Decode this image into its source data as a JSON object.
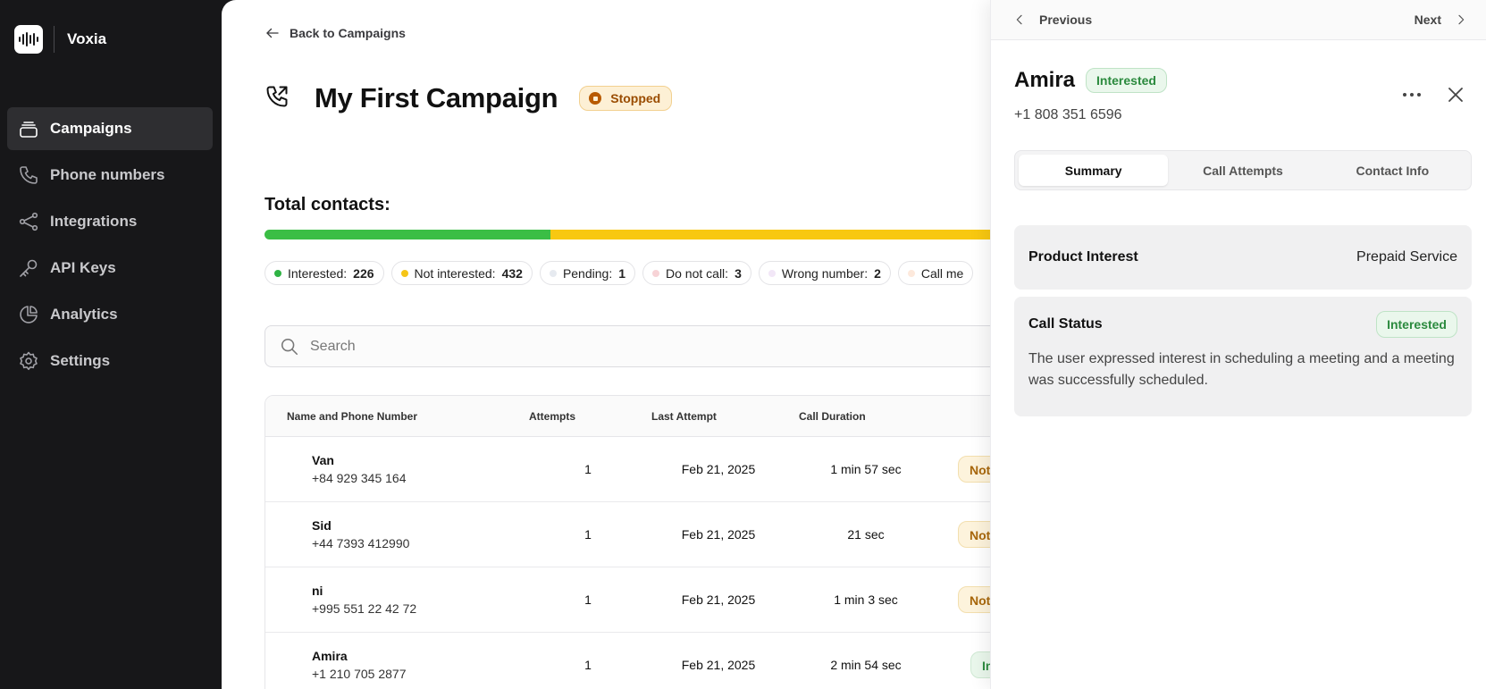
{
  "app": {
    "name": "Voxia"
  },
  "sidebar": {
    "items": [
      {
        "label": "Campaigns",
        "icon": "campaigns-icon",
        "active": true
      },
      {
        "label": "Phone numbers",
        "icon": "phone-icon"
      },
      {
        "label": "Integrations",
        "icon": "integrations-icon"
      },
      {
        "label": "API Keys",
        "icon": "key-icon"
      },
      {
        "label": "Analytics",
        "icon": "pie-chart-icon"
      },
      {
        "label": "Settings",
        "icon": "gear-icon"
      }
    ]
  },
  "header": {
    "back_label": "Back to Campaigns",
    "title": "My First Campaign",
    "status": "Stopped"
  },
  "contacts": {
    "total_label": "Total contacts:",
    "interested_fraction": 0.39,
    "chips": [
      {
        "label": "Interested:",
        "count": "226",
        "color": "#2fb344"
      },
      {
        "label": "Not interested:",
        "count": "432",
        "color": "#f5c518"
      },
      {
        "label": "Pending:",
        "count": "1",
        "color": "#e6eaf0"
      },
      {
        "label": "Do not call:",
        "count": "3",
        "color": "#f7d3d6"
      },
      {
        "label": "Wrong number:",
        "count": "2",
        "color": "#f2e7f7"
      },
      {
        "label": "Call me",
        "count": "",
        "color": "#fde9dc"
      }
    ]
  },
  "search": {
    "placeholder": "Search",
    "value": ""
  },
  "table": {
    "columns": [
      "Name and Phone Number",
      "Attempts",
      "Last Attempt",
      "Call Duration"
    ],
    "rows": [
      {
        "name": "Van",
        "phone": "+84 929 345 164",
        "attempts": "1",
        "last": "Feb 21, 2025",
        "duration": "1 min 57 sec",
        "status": "Not",
        "kind": "ni"
      },
      {
        "name": "Sid",
        "phone": "+44 7393 412990",
        "attempts": "1",
        "last": "Feb 21, 2025",
        "duration": "21 sec",
        "status": "Not",
        "kind": "ni"
      },
      {
        "name": "ni",
        "phone": "+995 551 22 42 72",
        "attempts": "1",
        "last": "Feb 21, 2025",
        "duration": "1 min 3 sec",
        "status": "Not",
        "kind": "ni"
      },
      {
        "name": "Amira",
        "phone": "+1 210 705 2877",
        "attempts": "1",
        "last": "Feb 21, 2025",
        "duration": "2 min 54 sec",
        "status": "Int",
        "kind": "in"
      }
    ]
  },
  "panel": {
    "prev_label": "Previous",
    "next_label": "Next",
    "name": "Amira",
    "status": "Interested",
    "phone": "+1 808 351 6596",
    "tabs": [
      "Summary",
      "Call Attempts",
      "Contact Info"
    ],
    "active_tab": "Summary",
    "product_interest": {
      "title": "Product Interest",
      "value": "Prepaid Service"
    },
    "call_status": {
      "title": "Call Status",
      "badge": "Interested",
      "description": "The user expressed interest in scheduling a meeting and a meeting was successfully scheduled."
    }
  }
}
